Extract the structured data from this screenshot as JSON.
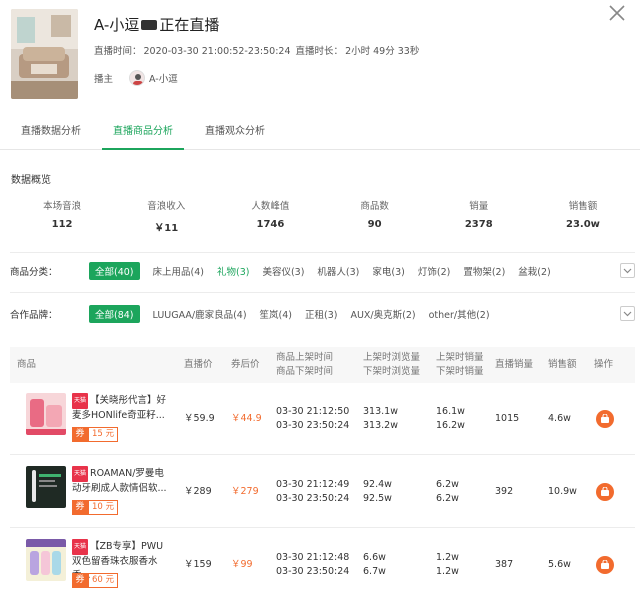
{
  "header": {
    "title": "A-小逗",
    "live_status": "正在直播",
    "live_time_label": "直播时间：",
    "live_time": "2020-03-30 21:00:52-23:50:24",
    "duration_label": "直播时长：",
    "duration": "2小时 49分 33秒",
    "anchor_label": "播主",
    "anchor_name": "A-小逗"
  },
  "tabs": [
    "直播数据分析",
    "直播商品分析",
    "直播观众分析"
  ],
  "active_tab": 1,
  "overview": {
    "title": "数据概览",
    "stats": [
      {
        "label": "本场音浪",
        "value": "112"
      },
      {
        "label": "音浪收入",
        "value": "￥11"
      },
      {
        "label": "人数峰值",
        "value": "1746"
      },
      {
        "label": "商品数",
        "value": "90"
      },
      {
        "label": "销量",
        "value": "2378"
      },
      {
        "label": "销售额",
        "value": "23.0w"
      }
    ]
  },
  "category_filter": {
    "label": "商品分类：",
    "chips": [
      "全部(40)",
      "床上用品(4)",
      "礼物(3)",
      "美容仪(3)",
      "机器人(3)",
      "家电(3)",
      "灯饰(2)",
      "置物架(2)",
      "盆栽(2)"
    ]
  },
  "brand_filter": {
    "label": "合作品牌：",
    "chips": [
      "全部(84)",
      "LUUGAA/鹿家良品(4)",
      "笙岚(4)",
      "正租(3)",
      "AUX/奥克斯(2)",
      "other/其他(2)"
    ]
  },
  "table": {
    "headers": {
      "product": "商品",
      "live_price": "直播价",
      "coupon_price": "券后价",
      "shelf_up_time": "商品上架时间",
      "shelf_down_time": "商品下架时间",
      "up_views": "上架时浏览量",
      "down_views": "下架时浏览量",
      "up_sales": "上架时销量",
      "down_sales": "下架时销量",
      "live_sales": "直播销量",
      "revenue": "销售额",
      "action": "操作"
    },
    "rows": [
      {
        "tag": "天猫",
        "name": "【关晓彤代言】好麦多HONlife奇亚籽...",
        "coupon_label": "券",
        "coupon": "15 元",
        "live_price": "￥59.9",
        "coupon_price": "￥44.9",
        "up_time": "03-30 21:12:50",
        "down_time": "03-30 23:50:24",
        "up_views": "313.1w",
        "down_views": "313.2w",
        "up_sales": "16.1w",
        "down_sales": "16.2w",
        "live_sales": "1015",
        "revenue": "4.6w"
      },
      {
        "tag": "天猫",
        "name": "ROAMAN/罗曼电动牙刷成人款情侣软...",
        "coupon_label": "券",
        "coupon": "10 元",
        "live_price": "￥289",
        "coupon_price": "￥279",
        "up_time": "03-30 21:12:49",
        "down_time": "03-30 23:50:24",
        "up_views": "92.4w",
        "down_views": "92.5w",
        "up_sales": "6.2w",
        "down_sales": "6.2w",
        "live_sales": "392",
        "revenue": "10.9w"
      },
      {
        "tag": "天猫",
        "name": "【ZB专享】PWU双色留香珠衣服香水香...",
        "coupon_label": "券",
        "coupon": "60 元",
        "live_price": "￥159",
        "coupon_price": "￥99",
        "up_time": "03-30 21:12:48",
        "down_time": "03-30 23:50:24",
        "up_views": "6.6w",
        "down_views": "6.7w",
        "up_sales": "1.2w",
        "down_sales": "1.2w",
        "live_sales": "387",
        "revenue": "5.6w"
      }
    ]
  },
  "colors": {
    "accent": "#1ca55c",
    "orange": "#f26b2e"
  }
}
